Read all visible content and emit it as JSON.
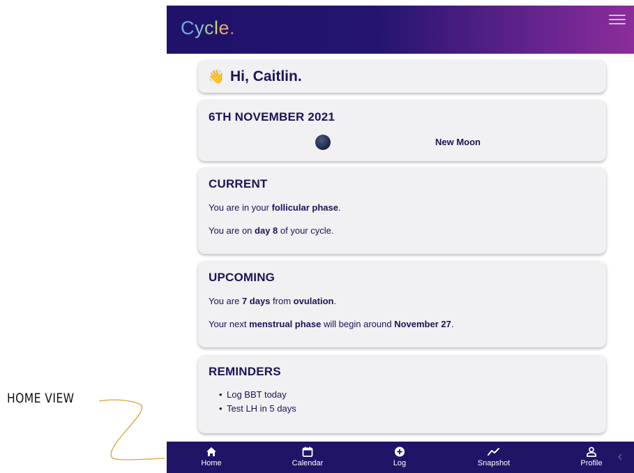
{
  "annotation": {
    "label": "HOME VIEW"
  },
  "header": {
    "logo_letters": [
      "C",
      "y",
      "c",
      "l",
      "e",
      "."
    ],
    "logo_colors": [
      "#6fa8e8",
      "#7fc0d8",
      "#9ad08a",
      "#c8d870",
      "#e8a86a",
      "#e070a0"
    ],
    "menu_icon": "hamburger-icon"
  },
  "greeting": {
    "emoji": "👋",
    "text": "Hi, Caitlin."
  },
  "date_card": {
    "title": "6TH NOVEMBER 2021",
    "moon_phase": "New Moon",
    "moon_icon": "moon-icon"
  },
  "current": {
    "title": "CURRENT",
    "line1": {
      "pre": "You are in your ",
      "bold": "follicular phase",
      "post": "."
    },
    "line2": {
      "pre": "You are on ",
      "bold": "day 8",
      "post": " of your cycle."
    }
  },
  "upcoming": {
    "title": "UPCOMING",
    "line1": {
      "pre": "You are ",
      "bold": "7 days",
      "mid": " from ",
      "bold2": "ovulation",
      "post": "."
    },
    "line2": {
      "pre": "Your next ",
      "bold": "menstrual phase",
      "mid": " will begin around ",
      "bold2": "November 27",
      "post": "."
    }
  },
  "reminders": {
    "title": "REMINDERS",
    "items": [
      "Log BBT today",
      "Test LH in 5 days"
    ]
  },
  "nav": {
    "items": [
      {
        "label": "Home",
        "icon": "home-icon"
      },
      {
        "label": "Calendar",
        "icon": "calendar-icon"
      },
      {
        "label": "Log",
        "icon": "plus-circle-icon"
      },
      {
        "label": "Snapshot",
        "icon": "trend-icon"
      },
      {
        "label": "Profile",
        "icon": "person-icon"
      }
    ]
  },
  "colors": {
    "header_start": "#1f1268",
    "header_end": "#8c2d9a",
    "nav": "#1f1466",
    "text": "#1a1456",
    "card": "#f1f0f3"
  }
}
